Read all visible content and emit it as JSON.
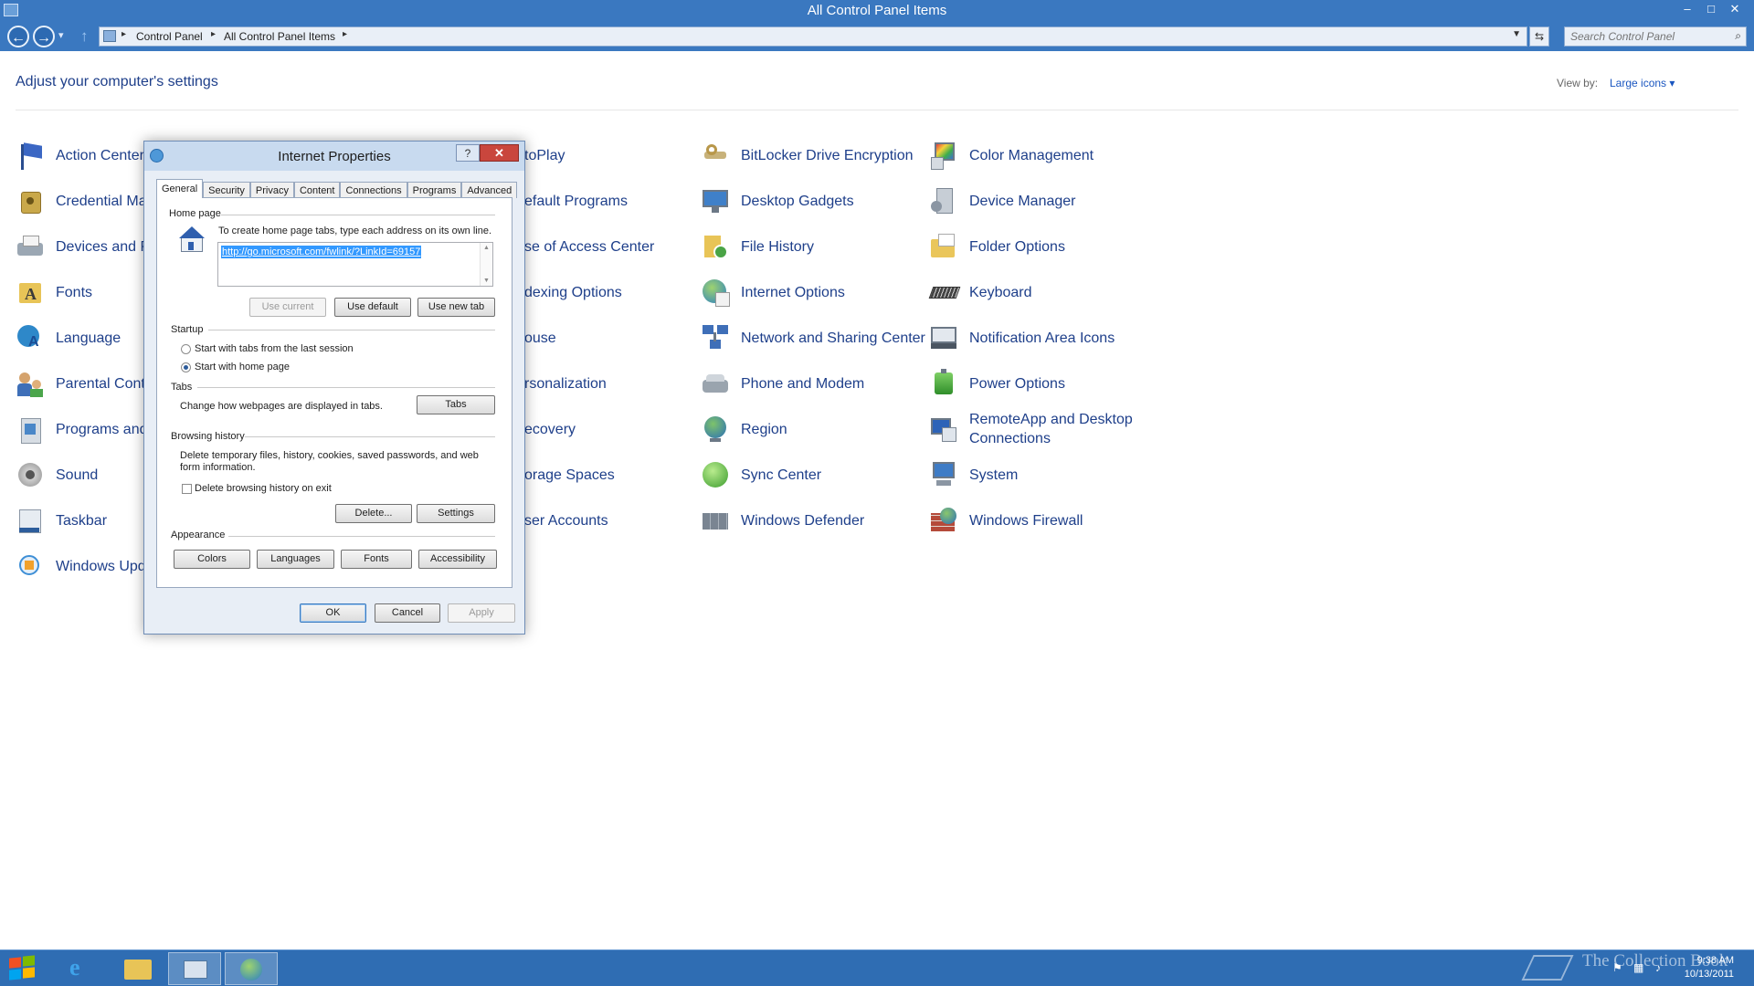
{
  "window": {
    "title": "All Control Panel Items"
  },
  "window_buttons": {
    "minimize": "–",
    "maximize": "□",
    "close": "✕"
  },
  "nav": {
    "back": "←",
    "forward": "→",
    "history": "▾",
    "up": "↑",
    "breadcrumbs": [
      "Control Panel",
      "All Control Panel Items"
    ],
    "refresh": "⇆",
    "search_placeholder": "Search Control Panel"
  },
  "heading": "Adjust your computer's settings",
  "view_by": {
    "label": "View by:",
    "value": "Large icons ▾"
  },
  "items": [
    {
      "label": "Action Center",
      "icon": "flag-icon"
    },
    {
      "label": "Credential Ma",
      "icon": "credential-vault-icon"
    },
    {
      "label": "Devices and P",
      "icon": "printer-icon"
    },
    {
      "label": "Fonts",
      "icon": "fonts-folder-icon"
    },
    {
      "label": "Language",
      "icon": "language-icon"
    },
    {
      "label": "Parental Cont",
      "icon": "family-icon"
    },
    {
      "label": "Programs and",
      "icon": "programs-icon"
    },
    {
      "label": "Sound",
      "icon": "speaker-icon"
    },
    {
      "label": "Taskbar",
      "icon": "taskbar-icon"
    },
    {
      "label": "Windows Upd",
      "icon": "update-icon"
    },
    {
      "label": "toPlay",
      "icon": "autoplay-icon"
    },
    {
      "label": "efault Programs",
      "icon": "default-programs-icon"
    },
    {
      "label": "se of Access Center",
      "icon": "ease-of-access-icon"
    },
    {
      "label": "dexing Options",
      "icon": "indexing-icon"
    },
    {
      "label": "ouse",
      "icon": "mouse-icon"
    },
    {
      "label": "rsonalization",
      "icon": "personalization-icon"
    },
    {
      "label": "ecovery",
      "icon": "recovery-icon"
    },
    {
      "label": "orage Spaces",
      "icon": "storage-icon"
    },
    {
      "label": "ser Accounts",
      "icon": "user-accounts-icon"
    },
    {
      "label": "BitLocker Drive Encryption",
      "icon": "bitlocker-key-icon"
    },
    {
      "label": "Desktop Gadgets",
      "icon": "gadgets-monitor-icon"
    },
    {
      "label": "File History",
      "icon": "file-history-icon"
    },
    {
      "label": "Internet Options",
      "icon": "globe-icon"
    },
    {
      "label": "Network and Sharing Center",
      "icon": "network-icon"
    },
    {
      "label": "Phone and Modem",
      "icon": "phone-icon"
    },
    {
      "label": "Region",
      "icon": "region-globe-icon"
    },
    {
      "label": "Sync Center",
      "icon": "sync-icon"
    },
    {
      "label": "Windows Defender",
      "icon": "defender-wall-icon"
    },
    {
      "label": "Color Management",
      "icon": "color-management-icon"
    },
    {
      "label": "Device Manager",
      "icon": "device-manager-icon"
    },
    {
      "label": "Folder Options",
      "icon": "folder-icon"
    },
    {
      "label": "Keyboard",
      "icon": "keyboard-icon"
    },
    {
      "label": "Notification Area Icons",
      "icon": "notification-area-icon"
    },
    {
      "label": "Power Options",
      "icon": "power-icon"
    },
    {
      "label": "RemoteApp and Desktop Connections",
      "icon": "remoteapp-icon"
    },
    {
      "label": "System",
      "icon": "system-icon"
    },
    {
      "label": "Windows Firewall",
      "icon": "firewall-icon"
    }
  ],
  "dialog": {
    "title": "Internet Properties",
    "help": "?",
    "close": "✕",
    "tabs": [
      "General",
      "Security",
      "Privacy",
      "Content",
      "Connections",
      "Programs",
      "Advanced"
    ],
    "home_page": {
      "group_label": "Home page",
      "instructions": "To create home page tabs, type each address on its own line.",
      "url": "http://go.microsoft.com/fwlink/?LinkId=69157",
      "buttons": [
        "Use current",
        "Use default",
        "Use new tab"
      ]
    },
    "startup": {
      "group_label": "Startup",
      "options": [
        "Start with tabs from the last session",
        "Start with home page"
      ],
      "selected": "Start with home page"
    },
    "tabs_group": {
      "group_label": "Tabs",
      "text": "Change how webpages are displayed in tabs.",
      "button": "Tabs"
    },
    "browsing_history": {
      "group_label": "Browsing history",
      "text": "Delete temporary files, history, cookies, saved passwords, and web form information.",
      "checkbox_label": "Delete browsing history on exit",
      "checked": false,
      "buttons": [
        "Delete...",
        "Settings"
      ]
    },
    "appearance": {
      "group_label": "Appearance",
      "buttons": [
        "Colors",
        "Languages",
        "Fonts",
        "Accessibility"
      ]
    },
    "footer": {
      "ok": "OK",
      "cancel": "Cancel",
      "apply": "Apply"
    }
  },
  "taskbar": {
    "time": "9:38 AM",
    "date": "10/13/2011",
    "watermark": "The Collection Book"
  },
  "colors": {
    "accent": "#3a78c0",
    "link": "#1e3f8a",
    "taskbar": "#2f6db3",
    "selection": "#3399ff"
  }
}
